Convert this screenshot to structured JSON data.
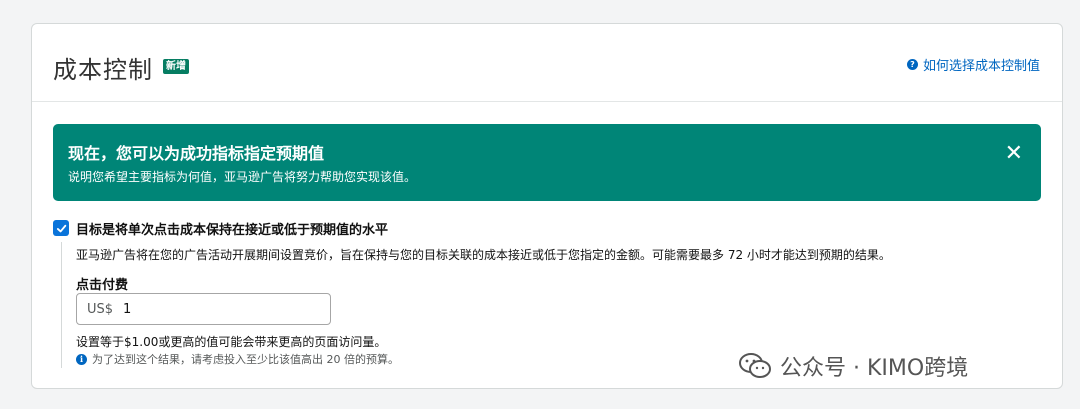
{
  "card": {
    "title": "成本控制",
    "badge": "新增",
    "help_link": "如何选择成本控制值"
  },
  "banner": {
    "title": "现在，您可以为成功指标指定预期值",
    "text": "说明您希望主要指标为何值，亚马逊广告将努力帮助您实现该值。",
    "close_icon": "close-icon"
  },
  "goal": {
    "checked": true,
    "label": "目标是将单次点击成本保持在接近或低于预期值的水平",
    "description": "亚马逊广告将在您的广告活动开展期间设置竞价，旨在保持与您的目标关联的成本接近或低于您指定的金额。可能需要最多 72 小时才能达到预期的结果。"
  },
  "cpc": {
    "label": "点击付费",
    "prefix": "US$",
    "value": "1",
    "hint": "设置等于$1.00或更高的值可能会带来更高的页面访问量。",
    "tip": "为了达到这个结果，请考虑投入至少比该值高出 20 倍的预算。"
  },
  "watermark": {
    "text": "公众号 · KIMO跨境"
  },
  "colors": {
    "banner_bg": "#008577",
    "badge_bg": "#067d62",
    "link": "#0066c0",
    "checkbox": "#0a74da"
  }
}
